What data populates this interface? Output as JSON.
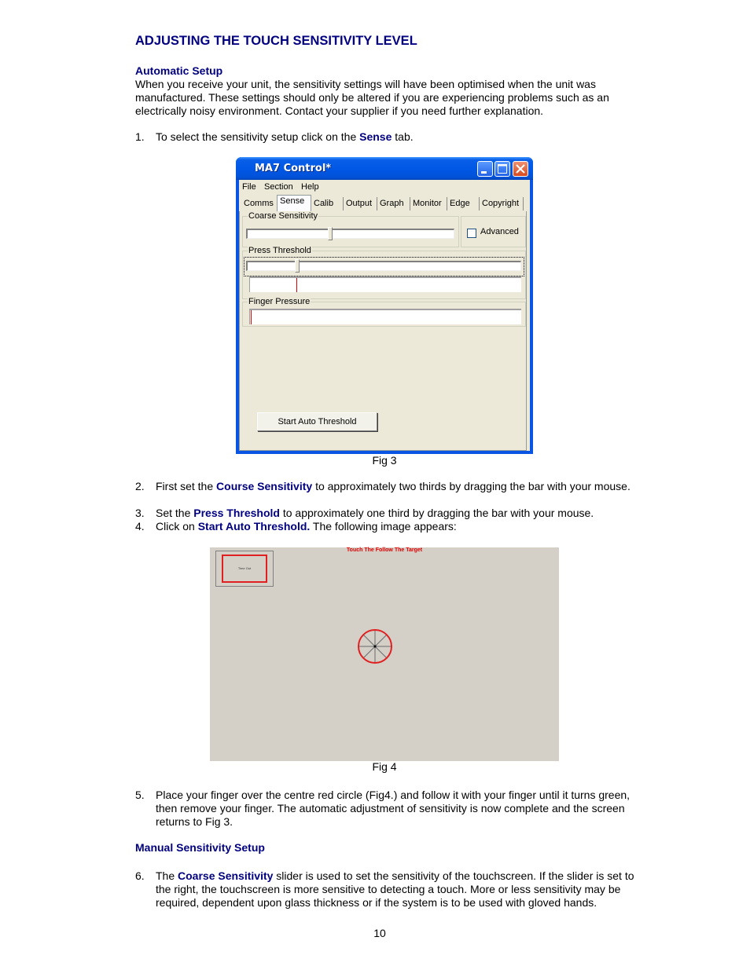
{
  "heading": "ADJUSTING THE TOUCH SENSITIVITY LEVEL",
  "automatic_setup": {
    "title": "Automatic Setup",
    "paragraph": "When you receive your unit, the sensitivity settings will have been optimised when the unit was manufactured. These settings should only be altered if you are experiencing problems such as an electrically noisy environment. Contact your supplier if you need further explanation."
  },
  "steps": [
    {
      "num": "1.",
      "pre": "To select the sensitivity setup click on the ",
      "kw": "Sense",
      "post": " tab."
    },
    {
      "num": "2.",
      "pre": "First set the ",
      "kw": "Course Sensitivity",
      "post": " to approximately two thirds by dragging the bar with your mouse."
    },
    {
      "num": "3.",
      "pre": "Set the ",
      "kw": "Press Threshold",
      "post": " to approximately one third by dragging the bar with your mouse."
    },
    {
      "num": "4.",
      "pre": "Click on ",
      "kw": "Start Auto Threshold.",
      "post": " The following image appears:"
    },
    {
      "num": "5.",
      "pre": "Place your finger over the centre red circle (Fig4.) and follow it with your finger until it turns green, then remove your finger. The automatic adjustment of sensitivity is now complete and the screen returns to Fig 3.",
      "kw": "",
      "post": ""
    },
    {
      "num": "6.",
      "pre": "The ",
      "kw": "Coarse Sensitivity",
      "post": " slider is used to set the sensitivity of the touchscreen. If the slider is set to the right, the touchscreen is more sensitive to detecting a touch. More or less sensitivity may be required, dependent upon glass thickness or if the system is to be used with gloved hands."
    }
  ],
  "manual_setup": {
    "title": "Manual Sensitivity Setup"
  },
  "fig3": {
    "caption": "Fig 3",
    "window_title": "MA7 Control*",
    "menu": [
      "File",
      "Section",
      "Help"
    ],
    "tabs": [
      "Comms",
      "Sense",
      "Calib",
      "Output",
      "Graph",
      "Monitor",
      "Edge",
      "Copyright"
    ],
    "active_tab": "Sense",
    "coarse_sensitivity": {
      "label": "Coarse Sensitivity",
      "value_fraction": 0.4
    },
    "advanced": {
      "label": "Advanced",
      "checked": false
    },
    "press_threshold": {
      "label": "Press Threshold",
      "value_fraction": 0.18,
      "marker_fraction": 0.17
    },
    "finger_pressure": {
      "label": "Finger Pressure",
      "marker_fraction": 0.0
    },
    "start_button": "Start Auto Threshold"
  },
  "fig4": {
    "caption": "Fig 4",
    "title": "Touch The Follow The Target",
    "timeout_label": "Time Out",
    "target_color": "#e02020"
  },
  "page_number": "10"
}
